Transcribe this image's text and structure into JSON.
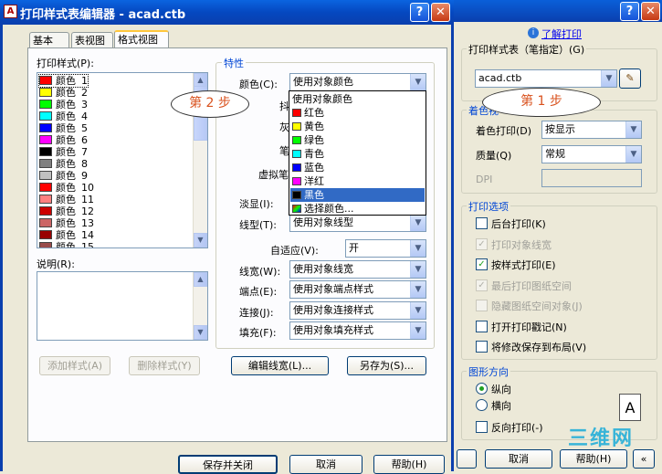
{
  "background_window": {
    "about_link": "了解打印",
    "plot_style_table": {
      "title": "打印样式表（笔指定）(G)",
      "value": "acad.ctb"
    },
    "shaded_viewport": {
      "title": "着色视",
      "shade_plot_label": "着色打印(D)",
      "shade_plot_value": "按显示",
      "quality_label": "质量(Q)",
      "quality_value": "常规",
      "dpi_label": "DPI"
    },
    "plot_options": {
      "title": "打印选项",
      "items": [
        {
          "label": "后台打印(K)",
          "checked": false,
          "enabled": true
        },
        {
          "label": "打印对象线宽",
          "checked": true,
          "enabled": false
        },
        {
          "label": "按样式打印(E)",
          "checked": true,
          "enabled": true
        },
        {
          "label": "最后打印图纸空间",
          "checked": true,
          "enabled": false
        },
        {
          "label": "隐藏图纸空间对象(J)",
          "checked": false,
          "enabled": false
        },
        {
          "label": "打开打印戳记(N)",
          "checked": false,
          "enabled": true
        },
        {
          "label": "将修改保存到布局(V)",
          "checked": false,
          "enabled": true
        }
      ]
    },
    "orientation": {
      "title": "图形方向",
      "portrait": "纵向",
      "landscape": "横向",
      "reverse": "反向打印(-)",
      "preview_glyph": "A"
    },
    "buttons": {
      "cancel": "取消",
      "help": "帮助(H)"
    },
    "watermark": "三维网"
  },
  "editor": {
    "title": "打印样式表编辑器 - acad.ctb",
    "tabs": [
      "基本",
      "表视图",
      "格式视图"
    ],
    "active_tab": 2,
    "plot_styles_label": "打印样式(P):",
    "plot_styles": [
      {
        "name": "颜色",
        "num": "1",
        "color": "#ff0000"
      },
      {
        "name": "颜色",
        "num": "2",
        "color": "#ffff00"
      },
      {
        "name": "颜色",
        "num": "3",
        "color": "#00ff00"
      },
      {
        "name": "颜色",
        "num": "4",
        "color": "#00ffff"
      },
      {
        "name": "颜色",
        "num": "5",
        "color": "#0000ff"
      },
      {
        "name": "颜色",
        "num": "6",
        "color": "#ff00ff"
      },
      {
        "name": "颜色",
        "num": "7",
        "color": "#000000"
      },
      {
        "name": "颜色",
        "num": "8",
        "color": "#808080"
      },
      {
        "name": "颜色",
        "num": "9",
        "color": "#c0c0c0"
      },
      {
        "name": "颜色",
        "num": "10",
        "color": "#ff0000"
      },
      {
        "name": "颜色",
        "num": "11",
        "color": "#ff7f7f"
      },
      {
        "name": "颜色",
        "num": "12",
        "color": "#cc0000"
      },
      {
        "name": "颜色",
        "num": "13",
        "color": "#cc6666"
      },
      {
        "name": "颜色",
        "num": "14",
        "color": "#990000"
      },
      {
        "name": "颜色",
        "num": "15",
        "color": "#994c4c"
      }
    ],
    "description_label": "说明(R):",
    "add_style": "添加样式(A)",
    "delete_style": "删除样式(Y)",
    "properties": {
      "title": "特性",
      "color_label": "颜色(C):",
      "color_value": "使用对象颜色",
      "dither_label": "抖",
      "grayscale_label": "灰",
      "pen_label": "笔",
      "virtual_pen_label": "虚拟笔",
      "screening_label": "淡显(I):",
      "linetype_label": "线型(T):",
      "linetype_value": "使用对象线型",
      "adaptive_label": "自适应(V):",
      "adaptive_value": "开",
      "lineweight_label": "线宽(W):",
      "lineweight_value": "使用对象线宽",
      "endstyle_label": "端点(E):",
      "endstyle_value": "使用对象端点样式",
      "joinstyle_label": "连接(J):",
      "joinstyle_value": "使用对象连接样式",
      "fillstyle_label": "填充(F):",
      "fillstyle_value": "使用对象填充样式"
    },
    "color_dropdown": {
      "items": [
        {
          "label": "使用对象颜色",
          "color": ""
        },
        {
          "label": "红色",
          "color": "#ff0000"
        },
        {
          "label": "黄色",
          "color": "#ffff00"
        },
        {
          "label": "绿色",
          "color": "#00ff00"
        },
        {
          "label": "青色",
          "color": "#00ffff"
        },
        {
          "label": "蓝色",
          "color": "#0000ff"
        },
        {
          "label": "洋红",
          "color": "#ff00ff"
        },
        {
          "label": "黑色",
          "color": "#000000"
        },
        {
          "label": "选择颜色...",
          "color": ""
        }
      ],
      "selected_index": 7
    },
    "edit_lineweights": "编辑线宽(L)...",
    "save_as": "另存为(S)...",
    "save_close": "保存并关闭",
    "cancel": "取消",
    "help": "帮助(H)"
  },
  "annotations": {
    "step1": "第 1 步",
    "step2": "第 2 步"
  }
}
